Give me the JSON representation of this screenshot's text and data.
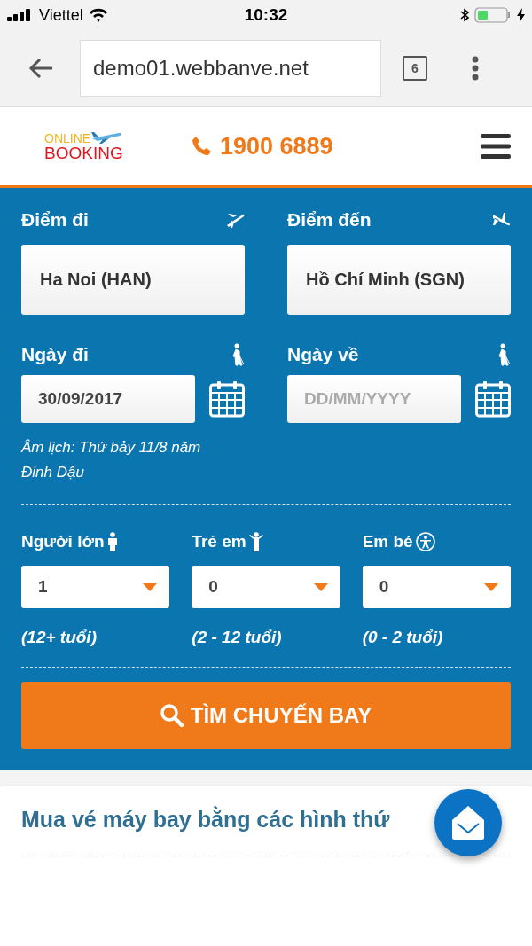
{
  "status_bar": {
    "carrier": "Viettel",
    "time": "10:32"
  },
  "browser": {
    "url": "demo01.webbanve.net",
    "tab_count": "6"
  },
  "header": {
    "logo_top": "ONLINE",
    "logo_bottom": "BOOKING",
    "phone": "1900 6889"
  },
  "places": [
    {
      "label": "Điểm đi",
      "kind": "takeoff",
      "value": "Ha Noi (HAN)"
    },
    {
      "label": "Điểm đến",
      "kind": "landing",
      "value": "Hồ Chí Minh (SGN)"
    }
  ],
  "dates": [
    {
      "label": "Ngày đi",
      "value": "30/09/2017"
    },
    {
      "label": "Ngày về",
      "placeholder": "DD/MM/YYYY"
    }
  ],
  "lunar_note": "Âm lịch: Thứ bảy 11/8 năm Đinh Dậu",
  "passengers": [
    {
      "label": "Người lớn",
      "kind": "adult",
      "value": "1",
      "age_note": "(12+ tuổi)"
    },
    {
      "label": "Trẻ em",
      "kind": "child",
      "value": "0",
      "age_note": "(2 - 12 tuổi)"
    },
    {
      "label": "Em bé",
      "kind": "infant",
      "value": "0",
      "age_note": "(0 - 2 tuổi)"
    }
  ],
  "search_button": "TÌM CHUYẾN BAY",
  "section_title": "Mua vé máy bay bằng các hình thứ"
}
